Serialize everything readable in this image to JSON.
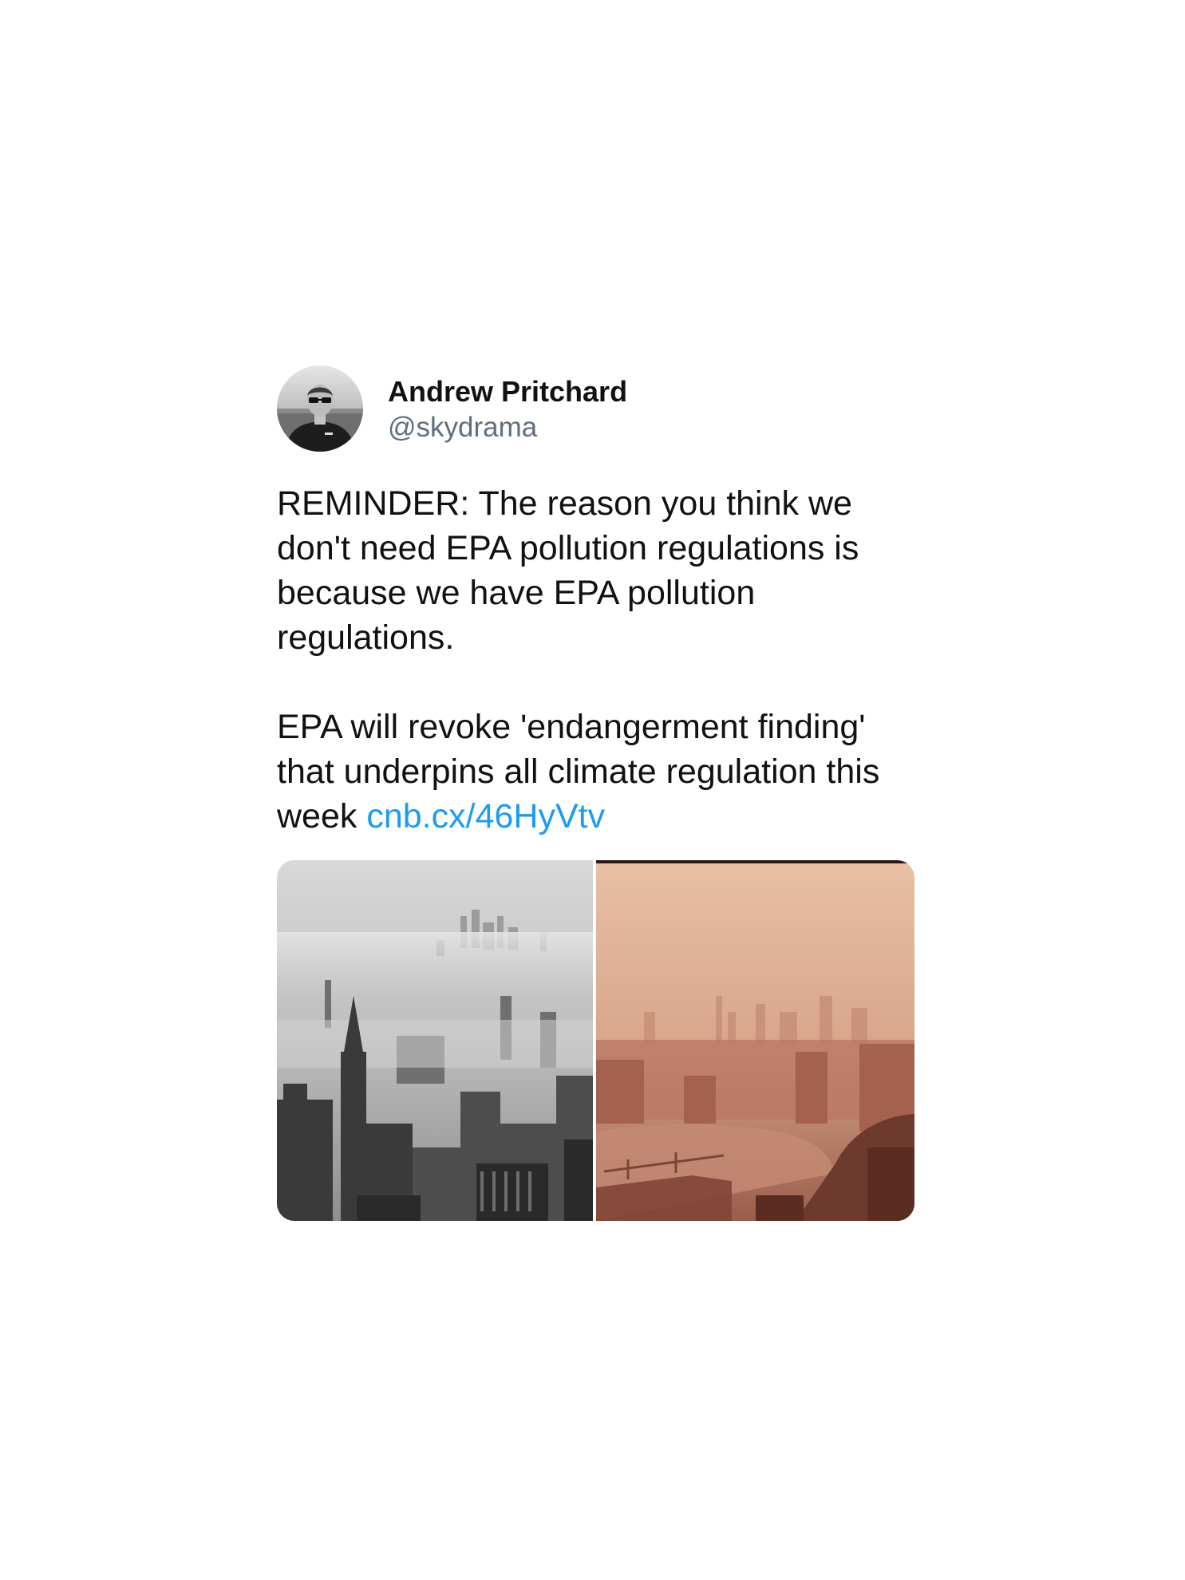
{
  "tweet": {
    "author": {
      "name": "Andrew Pritchard",
      "handle": "@skydrama",
      "avatar_icon": "profile-photo"
    },
    "paragraph_1": "REMINDER: The reason you think we don't need EPA pollution regulations is because we have EPA pollution regulations.",
    "paragraph_2_text": "EPA will revoke 'endangerment finding' that underpins all climate regulation this week ",
    "link_text": "cnb.cx/46HyVtv",
    "media": [
      {
        "description_icon": "smog-city-photo-bw"
      },
      {
        "description_icon": "smog-city-photo-sepia"
      }
    ]
  },
  "colors": {
    "link": "#1d9bf0",
    "handle": "#5f6f7e",
    "text": "#111111"
  }
}
